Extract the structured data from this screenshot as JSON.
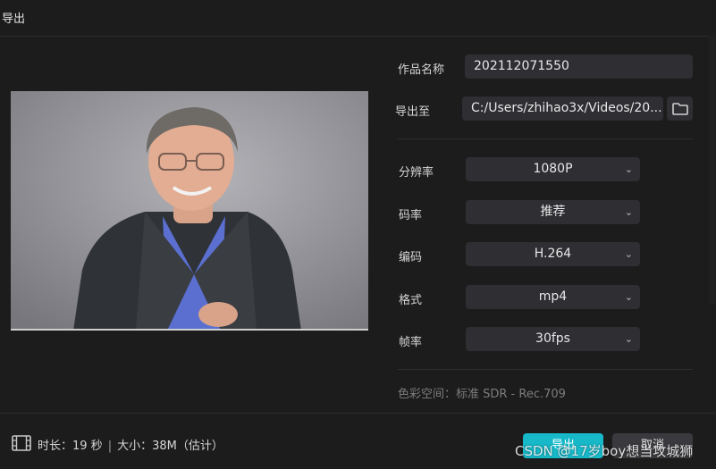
{
  "dialog": {
    "title": "导出"
  },
  "form": {
    "name_label": "作品名称",
    "name_value": "202112071550",
    "export_to_label": "导出至",
    "export_path": "C:/Users/zhihao3x/Videos/20...",
    "resolution_label": "分辨率",
    "resolution_value": "1080P",
    "bitrate_label": "码率",
    "bitrate_value": "推荐",
    "codec_label": "编码",
    "codec_value": "H.264",
    "format_label": "格式",
    "format_value": "mp4",
    "framerate_label": "帧率",
    "framerate_value": "30fps",
    "color_space": "色彩空间：标准 SDR - Rec.709"
  },
  "footer": {
    "duration": "时长：19 秒",
    "separator": "|",
    "size": "大小：38M（估计）",
    "export_label": "导出",
    "cancel_label": "取消"
  },
  "watermark": "CSDN @17岁boy想当攻城狮",
  "icons": {
    "folder": "folder-icon",
    "film": "film-icon",
    "chevron": "chevron-down-icon"
  },
  "colors": {
    "accent": "#17b9c9",
    "background": "#1c1c1c",
    "field": "#2e2e33"
  }
}
